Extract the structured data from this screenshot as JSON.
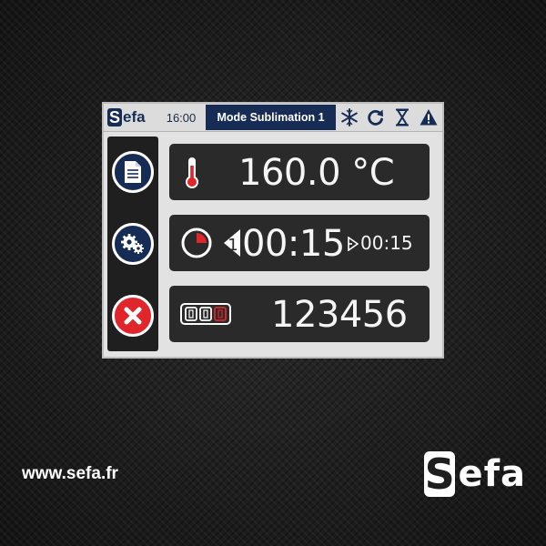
{
  "screen": {
    "topbar": {
      "logo_initial": "S",
      "logo_rest": "efa",
      "time": "16:00",
      "mode": "Mode Sublimation 1",
      "icons": [
        "snowflake-icon",
        "refresh-icon",
        "hourglass-icon",
        "warning-icon"
      ]
    },
    "sidebar": {
      "buttons": [
        "document-icon",
        "settings-gears-icon",
        "close-icon"
      ]
    },
    "temperature": {
      "value": "160.0 °C"
    },
    "timer": {
      "main": "00:15",
      "secondary": "00:15",
      "progress": 0.25
    },
    "counter": {
      "value": "123456"
    }
  },
  "footer": {
    "website": "www.sefa.fr",
    "brand_initial": "S",
    "brand_rest": "efa"
  },
  "colors": {
    "navy": "#162c55",
    "accent_red": "#e0262b",
    "panel_dark": "#2a2a2a"
  }
}
